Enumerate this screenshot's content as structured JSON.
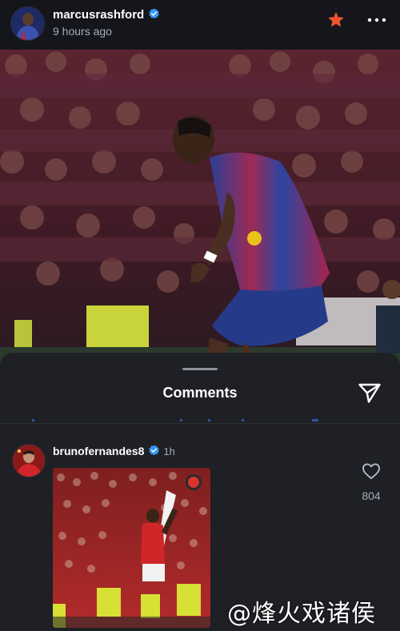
{
  "post": {
    "username": "marcusrashford",
    "time": "9 hours ago",
    "verified": true
  },
  "icons": {
    "verified": "verified-badge-icon",
    "star": "star-icon",
    "more": "more-horizontal-icon",
    "share": "send-icon",
    "like": "heart-icon"
  },
  "colors": {
    "star": "#f0552c",
    "verified": "#3897f0",
    "sheet_bg": "#1e2025",
    "header_bg": "#14161c"
  },
  "comments_sheet": {
    "title": "Comments"
  },
  "comment": {
    "username": "brunofernandes8",
    "verified": true,
    "time": "1h",
    "likes": "804"
  },
  "watermark": "@烽火戏诸侯"
}
